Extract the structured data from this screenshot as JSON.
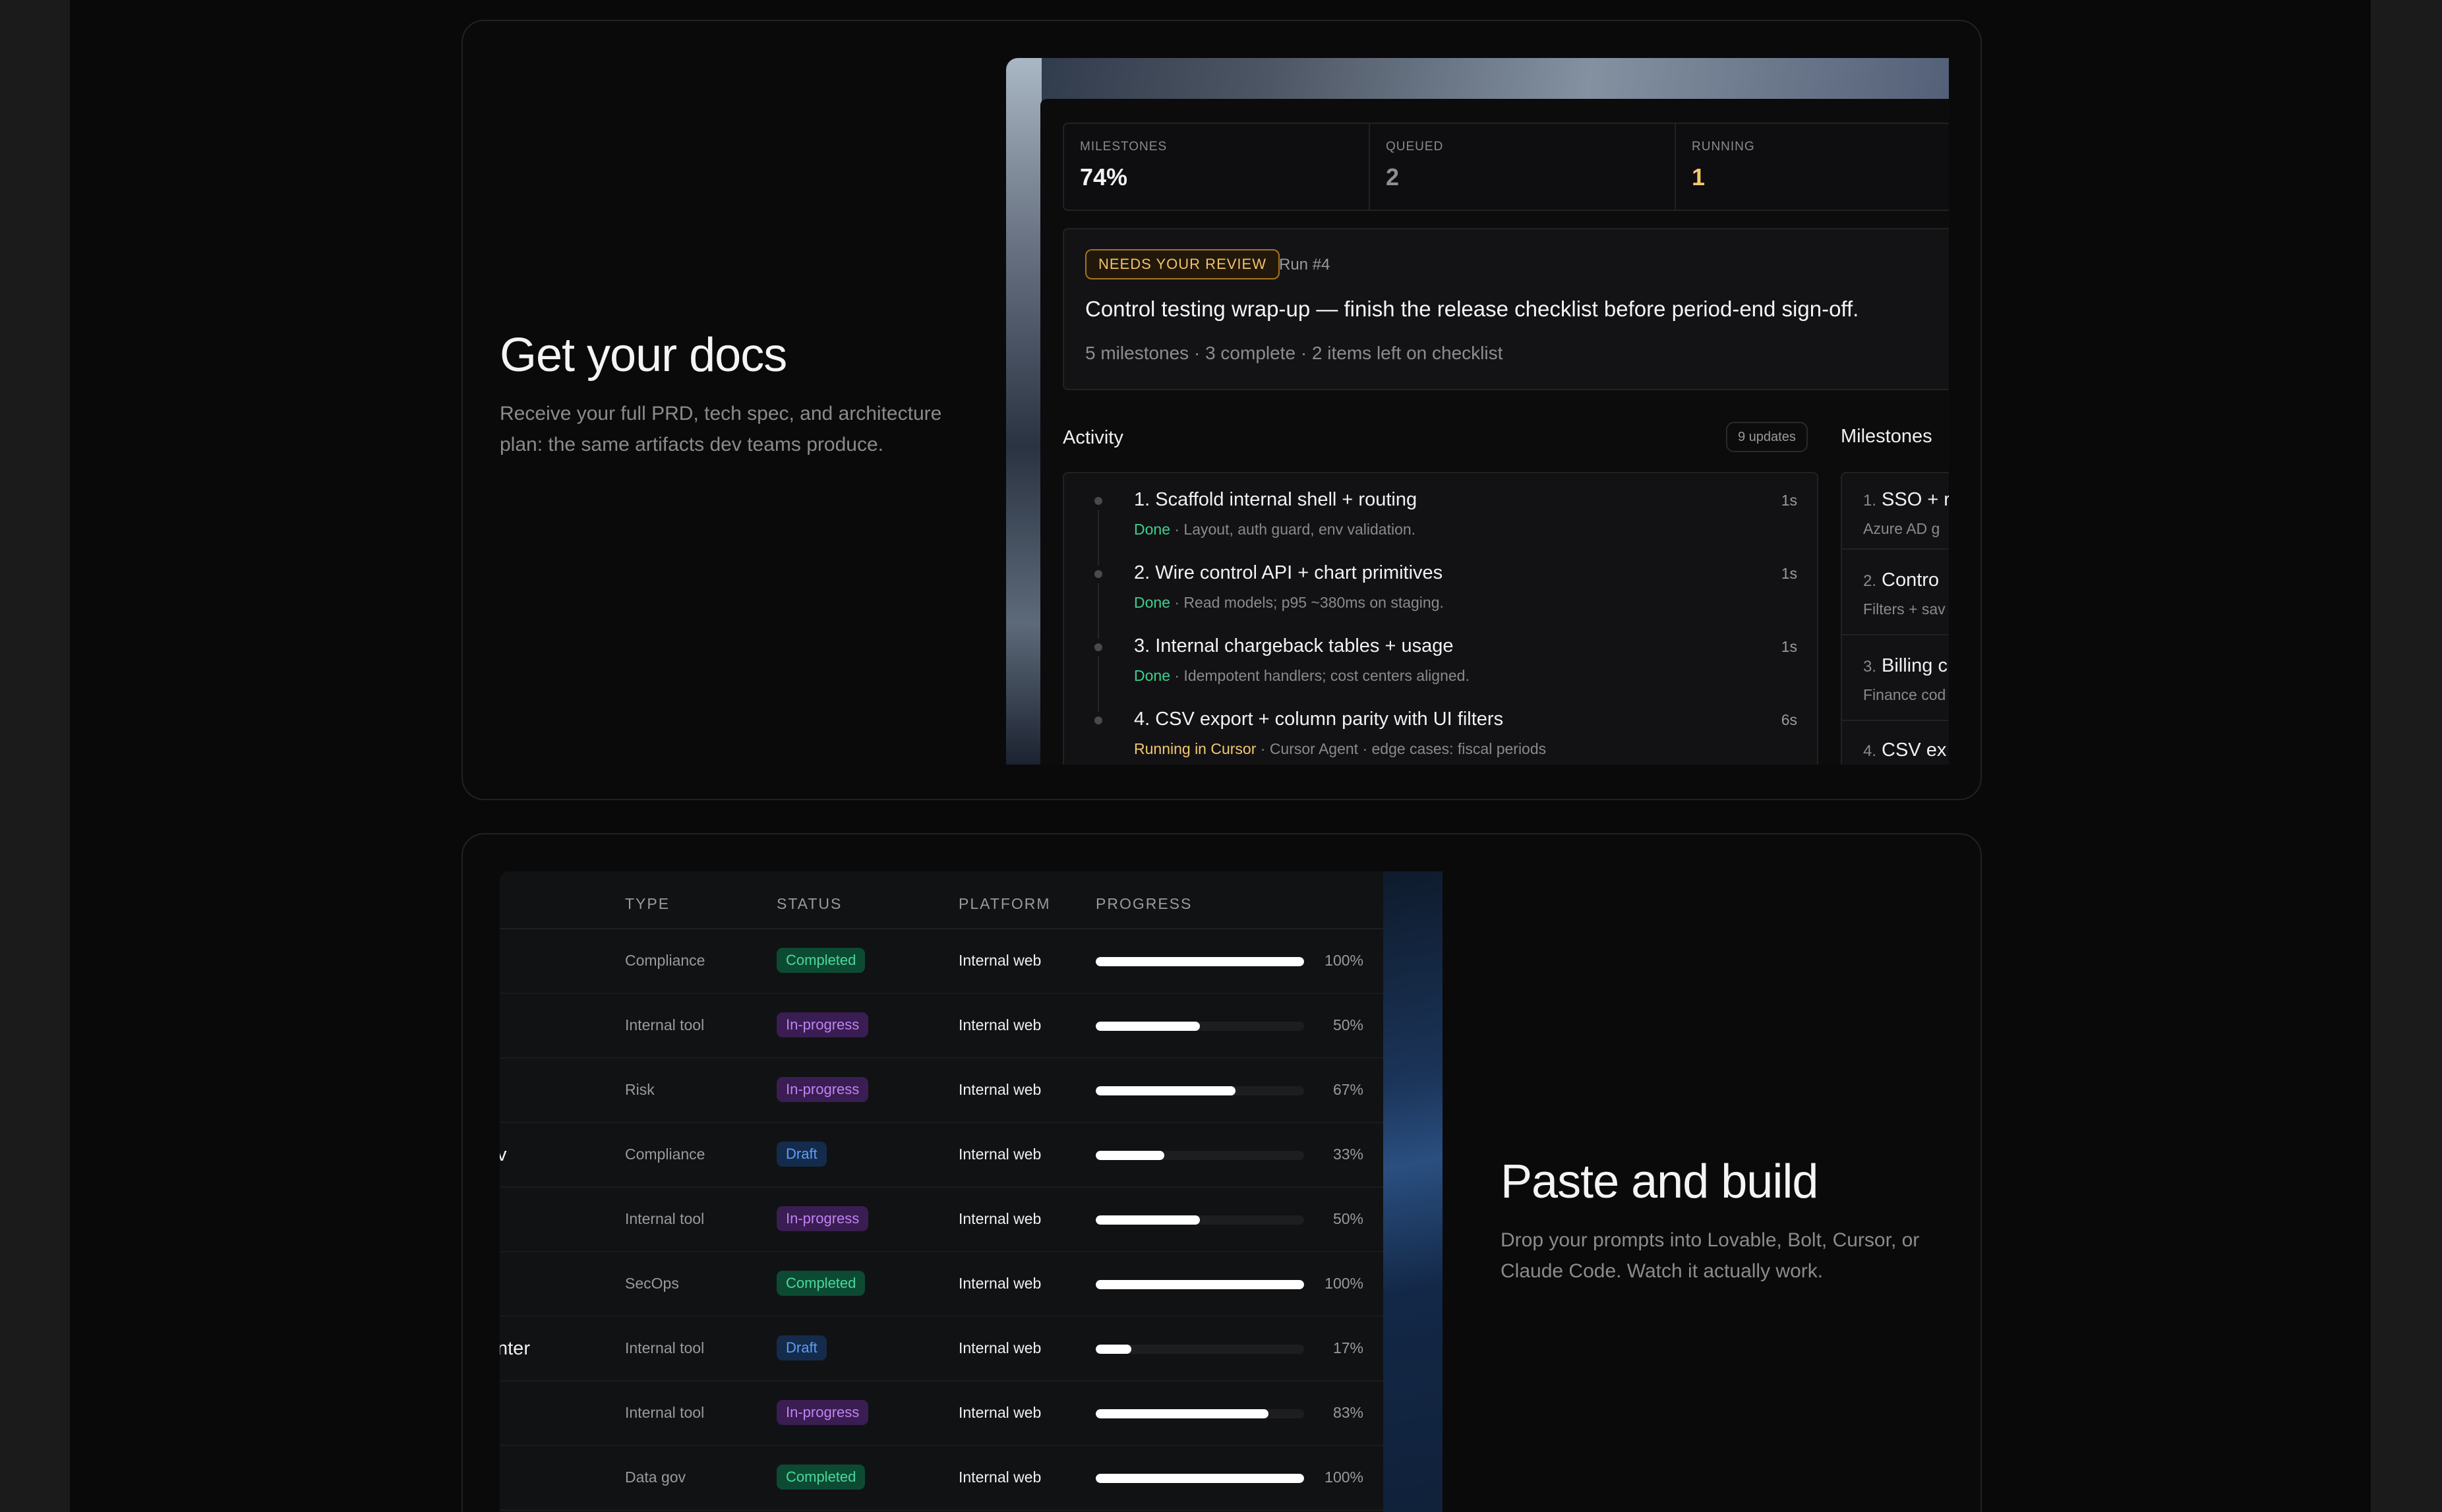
{
  "section1": {
    "heading": "Get your docs",
    "description": "Receive your full PRD, tech spec, and architecture plan: the same artifacts dev teams produce."
  },
  "dashboard": {
    "stats": [
      {
        "label": "MILESTONES",
        "value": "74%"
      },
      {
        "label": "QUEUED",
        "value": "2"
      },
      {
        "label": "RUNNING",
        "value": "1"
      }
    ],
    "review": {
      "badge": "NEEDS YOUR REVIEW",
      "run": "Run #4",
      "title": "Control testing wrap-up — finish the release checklist before period-end sign-off.",
      "subtitle": "5 milestones · 3 complete · 2 items left on checklist"
    },
    "activity_title": "Activity",
    "updates_badge": "9 updates",
    "milestones_title": "Milestones",
    "activity": [
      {
        "name": "1. Scaffold internal shell + routing",
        "status": "Done",
        "detail": " · Layout, auth guard, env validation.",
        "time": "1s"
      },
      {
        "name": "2. Wire control API + chart primitives",
        "status": "Done",
        "detail": " · Read models; p95 ~380ms on staging.",
        "time": "1s"
      },
      {
        "name": "3. Internal chargeback tables + usage",
        "status": "Done",
        "detail": " · Idempotent handlers; cost centers aligned.",
        "time": "1s"
      },
      {
        "name": "4. CSV export + column parity with UI filters",
        "status": "Running in Cursor",
        "detail": " · Cursor Agent · edge cases: fiscal periods",
        "time": "6s"
      }
    ],
    "milestones": [
      {
        "num": "1.",
        "title": "SSO + r",
        "sub": "Azure AD g"
      },
      {
        "num": "2.",
        "title": "Contro",
        "sub": "Filters + sav"
      },
      {
        "num": "3.",
        "title": "Billing c",
        "sub": "Finance cod"
      },
      {
        "num": "4.",
        "title": "CSV ex",
        "sub": ""
      }
    ]
  },
  "section2": {
    "heading": "Paste and build",
    "description": "Drop your prompts into Lovable, Bolt, Cursor, or Claude Code. Watch it actually work."
  },
  "table": {
    "headers": {
      "type": "TYPE",
      "status": "STATUS",
      "platform": "PLATFORM",
      "progress": "PROGRESS"
    },
    "rows": [
      {
        "name": "",
        "type": "Compliance",
        "status": "Completed",
        "status_kind": "completed",
        "platform": "Internal web",
        "progress": 100,
        "pct": "100%"
      },
      {
        "name": "",
        "type": "Internal tool",
        "status": "In-progress",
        "status_kind": "inprog",
        "platform": "Internal web",
        "progress": 50,
        "pct": "50%"
      },
      {
        "name": "",
        "type": "Risk",
        "status": "In-progress",
        "status_kind": "inprog",
        "platform": "Internal web",
        "progress": 67,
        "pct": "67%"
      },
      {
        "name": "v",
        "type": "Compliance",
        "status": "Draft",
        "status_kind": "draft",
        "platform": "Internal web",
        "progress": 33,
        "pct": "33%"
      },
      {
        "name": "",
        "type": "Internal tool",
        "status": "In-progress",
        "status_kind": "inprog",
        "platform": "Internal web",
        "progress": 50,
        "pct": "50%"
      },
      {
        "name": "",
        "type": "SecOps",
        "status": "Completed",
        "status_kind": "completed",
        "platform": "Internal web",
        "progress": 100,
        "pct": "100%"
      },
      {
        "name": "nter",
        "type": "Internal tool",
        "status": "Draft",
        "status_kind": "draft",
        "platform": "Internal web",
        "progress": 17,
        "pct": "17%"
      },
      {
        "name": "",
        "type": "Internal tool",
        "status": "In-progress",
        "status_kind": "inprog",
        "platform": "Internal web",
        "progress": 83,
        "pct": "83%"
      },
      {
        "name": "",
        "type": "Data gov",
        "status": "Completed",
        "status_kind": "completed",
        "platform": "Internal web",
        "progress": 100,
        "pct": "100%"
      }
    ]
  }
}
